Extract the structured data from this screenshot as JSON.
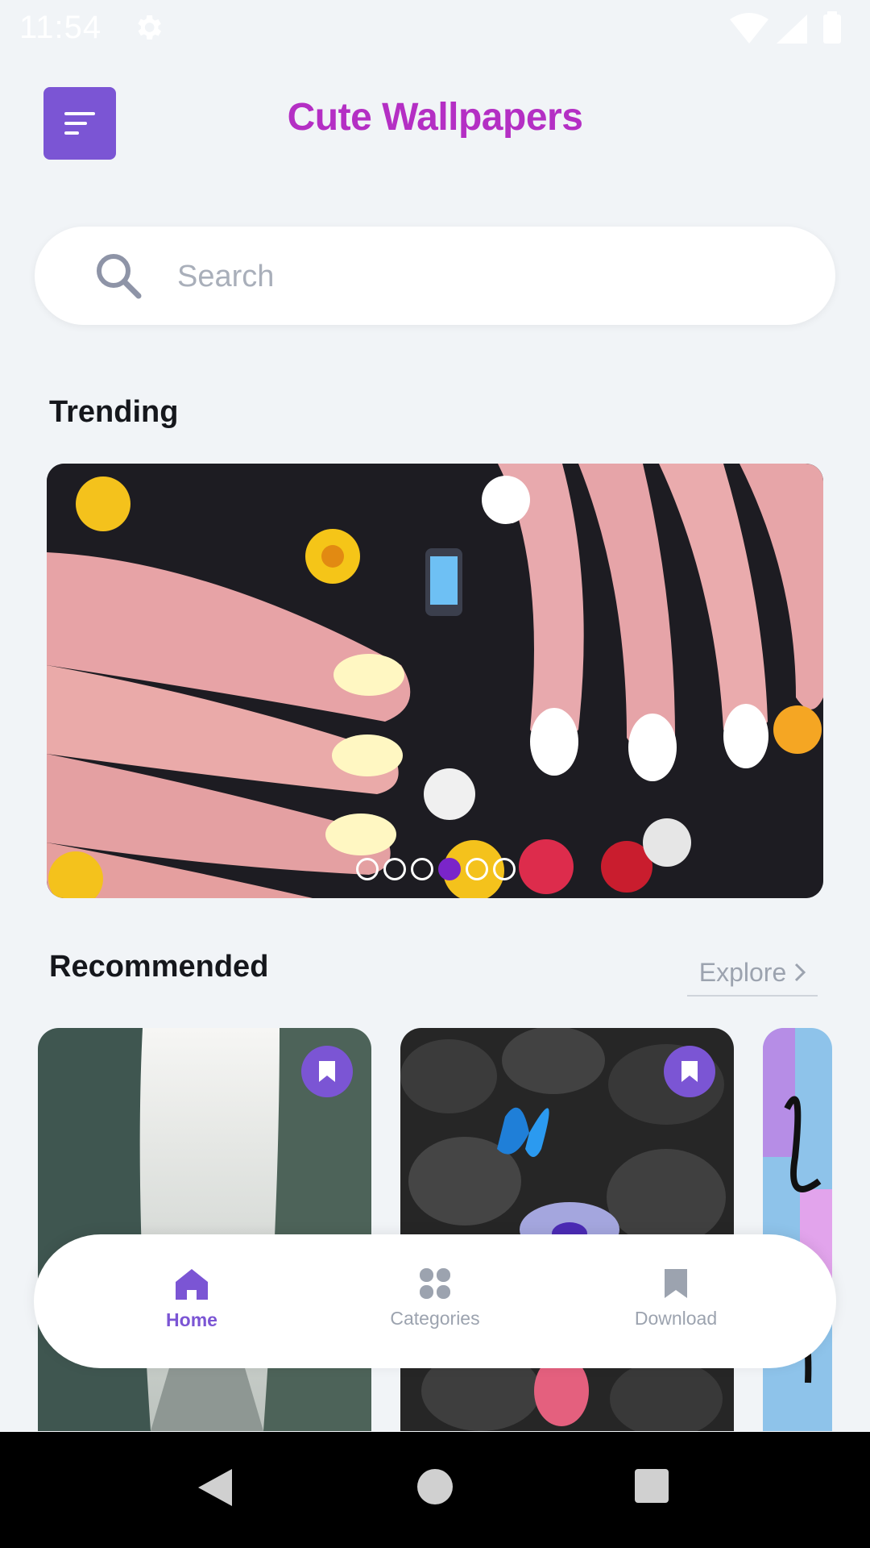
{
  "status_bar": {
    "time": "11:54"
  },
  "header": {
    "title": "Cute Wallpapers"
  },
  "search": {
    "placeholder": "Search"
  },
  "trending": {
    "title": "Trending",
    "carousel": {
      "count": 6,
      "active_index": 3
    }
  },
  "recommended": {
    "title": "Recommended",
    "explore_label": "Explore"
  },
  "bottom_nav": {
    "items": [
      {
        "label": "Home",
        "icon": "home-icon",
        "active": true
      },
      {
        "label": "Categories",
        "icon": "categories-icon",
        "active": false
      },
      {
        "label": "Download",
        "icon": "bookmark-icon",
        "active": false
      }
    ]
  },
  "colors": {
    "accent": "#7b55d4",
    "title": "#b42fc4",
    "inactive": "#9ca3af",
    "background": "#f1f4f7"
  }
}
